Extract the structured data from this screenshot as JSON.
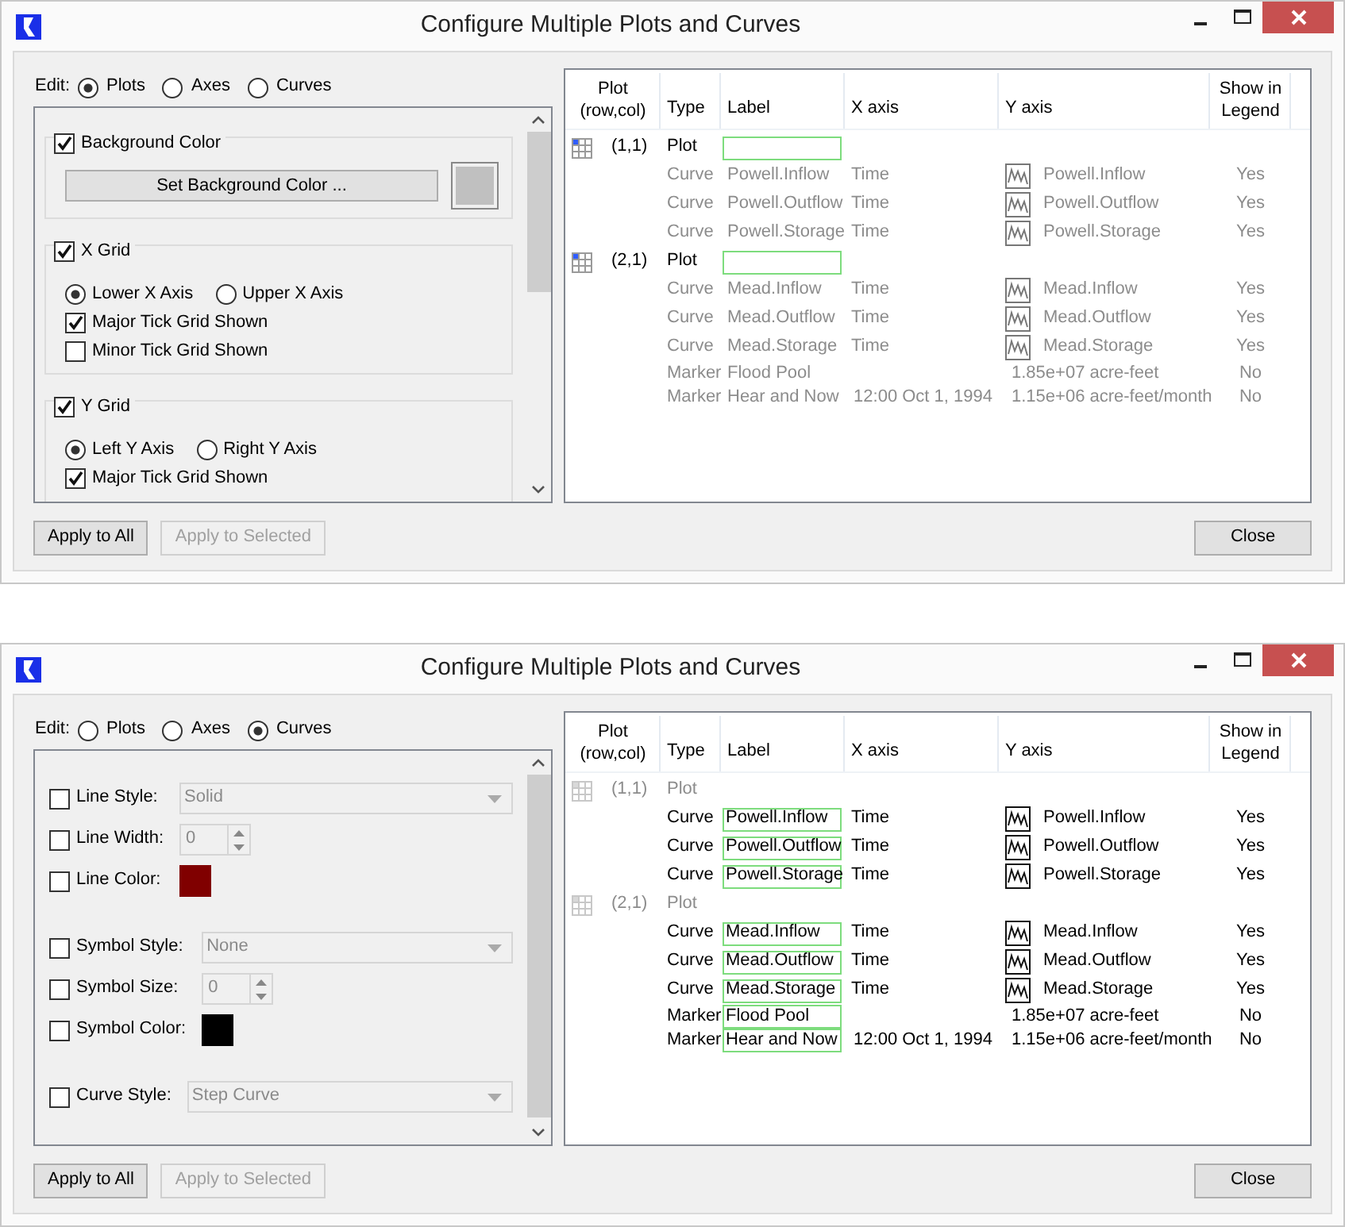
{
  "windows": [
    {
      "title": "Configure Multiple Plots and Curves",
      "edit": {
        "label": "Edit:",
        "options": [
          {
            "label": "Plots",
            "selected": true
          },
          {
            "label": "Axes",
            "selected": false
          },
          {
            "label": "Curves",
            "selected": false
          }
        ]
      },
      "panel": {
        "kind": "plots",
        "groups": [
          {
            "title": "Background Color",
            "checked": true,
            "button": "Set Background Color ...",
            "color": "#c0c0c0"
          },
          {
            "title": "X Grid",
            "checked": true,
            "radios": [
              {
                "label": "Lower X Axis",
                "selected": true
              },
              {
                "label": "Upper X Axis",
                "selected": false
              }
            ],
            "checks": [
              {
                "label": "Major Tick Grid Shown",
                "checked": true
              },
              {
                "label": "Minor Tick Grid Shown",
                "checked": false
              }
            ]
          },
          {
            "title": "Y Grid",
            "checked": true,
            "radios": [
              {
                "label": "Left Y Axis",
                "selected": true
              },
              {
                "label": "Right Y Axis",
                "selected": false
              }
            ],
            "checks": [
              {
                "label": "Major Tick Grid Shown",
                "checked": true
              }
            ]
          }
        ]
      },
      "apply_buttons": [
        {
          "label": "Apply to All",
          "disabled": false
        },
        {
          "label": "Apply to Selected",
          "disabled": true
        }
      ],
      "table": {
        "columns": [
          "Plot (row,col)",
          "Type",
          "Label",
          "X axis",
          "Y axis",
          "Show in Legend"
        ],
        "rows": [
          {
            "kind": "plot",
            "enabled": true,
            "position": "(1,1)",
            "type": "Plot"
          },
          {
            "kind": "curve",
            "enabled": false,
            "type": "Curve",
            "label": "Powell.Inflow",
            "x_axis": "Time",
            "y_axis": "Powell.Inflow",
            "legend": "Yes"
          },
          {
            "kind": "curve",
            "enabled": false,
            "type": "Curve",
            "label": "Powell.Outflow",
            "x_axis": "Time",
            "y_axis": "Powell.Outflow",
            "legend": "Yes"
          },
          {
            "kind": "curve",
            "enabled": false,
            "type": "Curve",
            "label": "Powell.Storage",
            "x_axis": "Time",
            "y_axis": "Powell.Storage",
            "legend": "Yes"
          },
          {
            "kind": "plot",
            "enabled": true,
            "position": "(2,1)",
            "type": "Plot"
          },
          {
            "kind": "curve",
            "enabled": false,
            "type": "Curve",
            "label": "Mead.Inflow",
            "x_axis": "Time",
            "y_axis": "Mead.Inflow",
            "legend": "Yes"
          },
          {
            "kind": "curve",
            "enabled": false,
            "type": "Curve",
            "label": "Mead.Outflow",
            "x_axis": "Time",
            "y_axis": "Mead.Outflow",
            "legend": "Yes"
          },
          {
            "kind": "curve",
            "enabled": false,
            "type": "Curve",
            "label": "Mead.Storage",
            "x_axis": "Time",
            "y_axis": "Mead.Storage",
            "legend": "Yes"
          },
          {
            "kind": "marker",
            "enabled": false,
            "type": "Marker",
            "label": "Flood Pool",
            "y_axis": "1.85e+07 acre-feet",
            "legend": "No"
          },
          {
            "kind": "marker",
            "enabled": false,
            "type": "Marker",
            "label": "Hear and Now",
            "x_axis": "12:00 Oct 1, 1994",
            "y_axis": "1.15e+06 acre-feet/month",
            "legend": "No"
          }
        ]
      },
      "close_button": "Close"
    },
    {
      "title": "Configure Multiple Plots and Curves",
      "edit": {
        "label": "Edit:",
        "options": [
          {
            "label": "Plots",
            "selected": false
          },
          {
            "label": "Axes",
            "selected": false
          },
          {
            "label": "Curves",
            "selected": true
          }
        ]
      },
      "panel": {
        "kind": "curves",
        "sections": [
          {
            "rows": [
              {
                "kind": "select",
                "label": "Line Style:",
                "checked": false,
                "value": "Solid"
              },
              {
                "kind": "spin",
                "label": "Line Width:",
                "checked": false,
                "value": "0"
              },
              {
                "kind": "color",
                "label": "Line Color:",
                "checked": false,
                "color": "#800000"
              }
            ]
          },
          {
            "rows": [
              {
                "kind": "select",
                "label": "Symbol Style:",
                "checked": false,
                "value": "None"
              },
              {
                "kind": "spin",
                "label": "Symbol Size:",
                "checked": false,
                "value": "0"
              },
              {
                "kind": "color",
                "label": "Symbol Color:",
                "checked": false,
                "color": "#000000"
              }
            ]
          },
          {
            "rows": [
              {
                "kind": "select",
                "label": "Curve Style:",
                "checked": false,
                "value": "Step Curve"
              }
            ]
          }
        ]
      },
      "apply_buttons": [
        {
          "label": "Apply to All",
          "disabled": false
        },
        {
          "label": "Apply to Selected",
          "disabled": true
        }
      ],
      "table": {
        "columns": [
          "Plot (row,col)",
          "Type",
          "Label",
          "X axis",
          "Y axis",
          "Show in Legend"
        ],
        "rows": [
          {
            "kind": "plot",
            "enabled": false,
            "position": "(1,1)",
            "type": "Plot"
          },
          {
            "kind": "curve",
            "enabled": true,
            "type": "Curve",
            "label": "Powell.Inflow",
            "x_axis": "Time",
            "y_axis": "Powell.Inflow",
            "legend": "Yes"
          },
          {
            "kind": "curve",
            "enabled": true,
            "type": "Curve",
            "label": "Powell.Outflow",
            "x_axis": "Time",
            "y_axis": "Powell.Outflow",
            "legend": "Yes"
          },
          {
            "kind": "curve",
            "enabled": true,
            "type": "Curve",
            "label": "Powell.Storage",
            "x_axis": "Time",
            "y_axis": "Powell.Storage",
            "legend": "Yes"
          },
          {
            "kind": "plot",
            "enabled": false,
            "position": "(2,1)",
            "type": "Plot"
          },
          {
            "kind": "curve",
            "enabled": true,
            "type": "Curve",
            "label": "Mead.Inflow",
            "x_axis": "Time",
            "y_axis": "Mead.Inflow",
            "legend": "Yes"
          },
          {
            "kind": "curve",
            "enabled": true,
            "type": "Curve",
            "label": "Mead.Outflow",
            "x_axis": "Time",
            "y_axis": "Mead.Outflow",
            "legend": "Yes"
          },
          {
            "kind": "curve",
            "enabled": true,
            "type": "Curve",
            "label": "Mead.Storage",
            "x_axis": "Time",
            "y_axis": "Mead.Storage",
            "legend": "Yes"
          },
          {
            "kind": "marker",
            "enabled": true,
            "type": "Marker",
            "label": "Flood Pool",
            "y_axis": "1.85e+07 acre-feet",
            "legend": "No"
          },
          {
            "kind": "marker",
            "enabled": true,
            "type": "Marker",
            "label": "Hear and Now",
            "x_axis": "12:00 Oct 1, 1994",
            "y_axis": "1.15e+06 acre-feet/month",
            "legend": "No"
          }
        ]
      },
      "close_button": "Close"
    }
  ]
}
